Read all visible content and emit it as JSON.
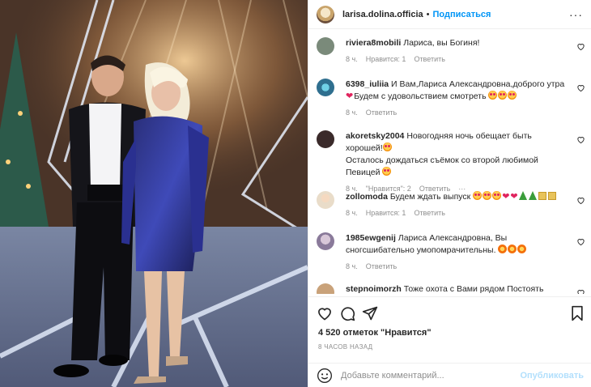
{
  "post": {
    "username": "larisa.dolina.officia",
    "dot": "•",
    "follow_label": "Подписаться",
    "more_label": "···",
    "likes_text": "4 520 отметок \"Нравится\"",
    "time_text": "8 ЧАСОВ НАЗАД"
  },
  "comments": [
    {
      "username": "riviera8mobili",
      "text": "Лариса, вы Богиня!",
      "time": "8 ч.",
      "likes": "Нравится: 1",
      "reply": "Ответить",
      "avatar_color": "#7a8a7a"
    },
    {
      "username": "6398_iuliia",
      "text": "И Вам,Лариса Александровна,доброго утра",
      "text2": "Будем с удовольствием смотреть",
      "time": "8 ч.",
      "reply": "Ответить",
      "avatar_color": "#2f6f8f"
    },
    {
      "username": "akoretsky2004",
      "text": "Новогодняя ночь обещает быть хорошей!",
      "text2": "Осталось дождаться съёмок со второй любимой Певицей",
      "time": "8 ч.",
      "likes": "\"Нравится\": 2",
      "reply": "Ответить",
      "more": "···",
      "avatar_color": "#3a2a2a"
    },
    {
      "username": "zollomoda",
      "text": "Будем ждать выпуск",
      "time": "8 ч.",
      "likes": "Нравится: 1",
      "reply": "Ответить",
      "avatar_color": "#e9dcc9"
    },
    {
      "username": "1985ewgenij",
      "text": "Лариса Александровна, Вы сногсшибательно умопомрачительны.",
      "time": "8 ч.",
      "reply": "Ответить",
      "avatar_color": "#8a7a9a"
    },
    {
      "username": "stepnoimorzh",
      "text": "Тоже охота с Вами рядом Постоять Лариса",
      "avatar_color": "#c9a27a"
    }
  ],
  "add_comment": {
    "placeholder": "Добавьте комментарий...",
    "post_label": "Опубликовать"
  },
  "icons": {
    "like": "heart-icon",
    "comment": "comment-icon",
    "share": "paper-plane-icon",
    "save": "bookmark-icon",
    "emoji": "smiley-icon"
  },
  "colors": {
    "link_blue": "#0095f6",
    "post_disabled": "#b2dffc",
    "muted": "#8e8e8e"
  }
}
